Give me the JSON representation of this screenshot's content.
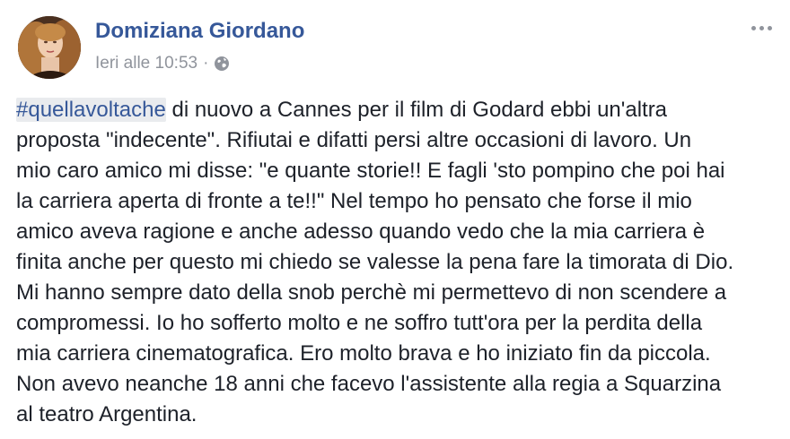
{
  "post": {
    "author": "Domiziana Giordano",
    "timestamp": "Ieri alle 10:53",
    "separator": "·",
    "privacy_icon": "globe-icon",
    "more_icon": "more-options-icon",
    "hashtag": "#quellavoltache",
    "lines": [
      " di nuovo a Cannes per il film di Godard ebbi un'altra",
      "proposta \"indecente\". Rifiutai e difatti persi altre occasioni di lavoro. Un",
      "mio caro amico mi disse: \"e quante storie!! E fagli 'sto pompino che poi hai",
      "la carriera aperta di fronte a te!!\" Nel tempo ho pensato che forse il mio",
      "amico aveva ragione e anche adesso quando vedo che la mia carriera è",
      "finita anche per questo mi chiedo se valesse la pena fare la timorata di Dio.",
      "Mi hanno sempre dato della snob perchè mi permettevo di non scendere a",
      "compromessi. Io ho sofferto molto e ne soffro tutt'ora per la perdita della",
      "mia carriera cinematografica. Ero molto brava e ho iniziato fin da piccola.",
      "Non avevo neanche 18 anni che facevo l'assistente alla regia a Squarzina",
      "al teatro Argentina."
    ]
  },
  "colors": {
    "link": "#365899",
    "text": "#1d2129",
    "meta": "#90949c",
    "hashtag_bg": "#e9ebee"
  }
}
